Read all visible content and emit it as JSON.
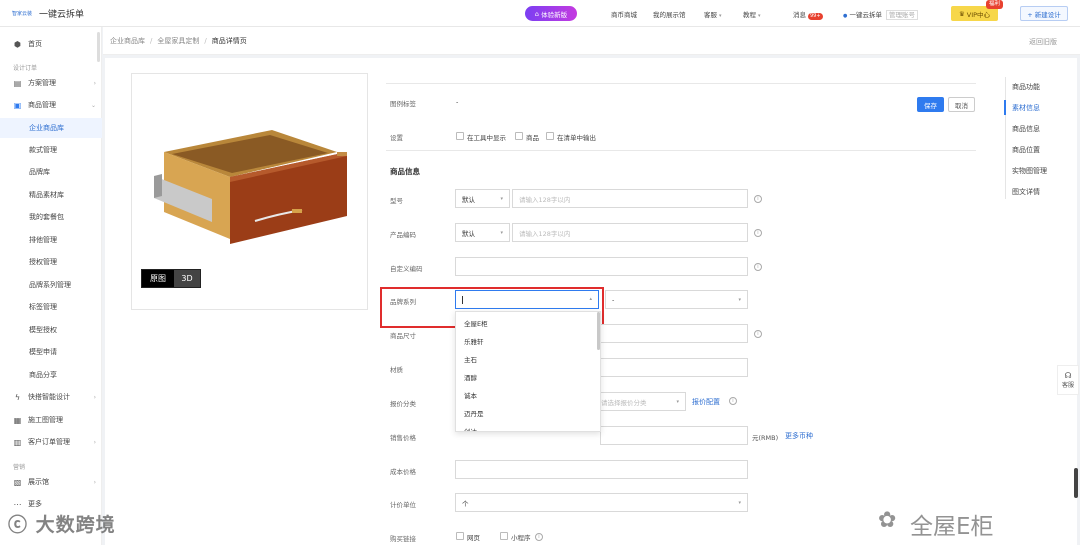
{
  "topbar": {
    "brand_small": "智家云装",
    "brand_name": "一键云拆单",
    "experience_label": "体验新版",
    "links": [
      "商币商城",
      "我的展示馆",
      "客服",
      "教程"
    ],
    "messages_label": "消息",
    "messages_count": "99+",
    "account_name": "一键云拆单",
    "account_role": "管理账号",
    "vip_label": "VIP中心",
    "welfare_label": "福利",
    "new_design_label": "+ 新建设计"
  },
  "sidebar": {
    "home": "首页",
    "group_design": "设计订单",
    "scheme_mgmt": "方案管理",
    "product_mgmt": "商品管理",
    "sub_items": [
      "企业商品库",
      "款式管理",
      "品牌库",
      "精品素材库",
      "我的套餐包",
      "排他管理",
      "授权管理",
      "品牌系列管理",
      "标签管理",
      "模型授权",
      "模型申请",
      "商品分享"
    ],
    "active_sub": "企业商品库",
    "smart_design": "快搭智能设计",
    "worksheet": "施工图管理",
    "customer_orders": "客户订单管理",
    "group_marketing": "营销",
    "showroom": "展示馆",
    "more": "更多"
  },
  "breadcrumb": {
    "items": [
      "企业商品库",
      "全屋家具定制",
      "商品详情页"
    ],
    "back_old": "返回旧版"
  },
  "view_toggle": {
    "original": "原图",
    "three_d": "3D"
  },
  "form": {
    "tag_label": "图例标签",
    "tag_value": "-",
    "save": "保存",
    "cancel": "取消",
    "setting_label": "设置",
    "setting_options": [
      "在工具中显示",
      "商品",
      "在清单中输出"
    ],
    "section_title": "商品信息",
    "model_label": "型号",
    "model_select": "默认",
    "model_placeholder": "请输入128字以内",
    "code_label": "产品编码",
    "code_select": "默认",
    "code_placeholder": "请输入128字以内",
    "custom_code_label": "自定义编码",
    "brand_series_label": "品牌系列",
    "brand_series_second": "-",
    "size_label": "商品尺寸",
    "material_label": "材质",
    "quote_category_label": "报价分类",
    "quote_category_placeholder": "请选择报价分类",
    "quote_config_link": "报价配置",
    "sale_price_label": "销售价格",
    "sale_price_unit": "元(RMB)",
    "more_currency_link": "更多币种",
    "cost_price_label": "成本价格",
    "pricing_unit_label": "计价单位",
    "pricing_unit_value": "个",
    "purchase_link_label": "购买链接",
    "purchase_options": [
      "网页",
      "小程序"
    ]
  },
  "brand_dropdown": {
    "options": [
      "全屋E柜",
      "乐雅轩",
      "主石",
      "酒醇",
      "诚本",
      "迈丹是",
      "创达"
    ]
  },
  "right_nav": {
    "items": [
      "商品功能",
      "素材信息",
      "商品信息",
      "商品位置",
      "实物图管理",
      "图文详情"
    ],
    "active": "素材信息"
  },
  "service_label": "客服",
  "watermarks": {
    "left": "大数跨境",
    "right": "全屋E柜"
  }
}
